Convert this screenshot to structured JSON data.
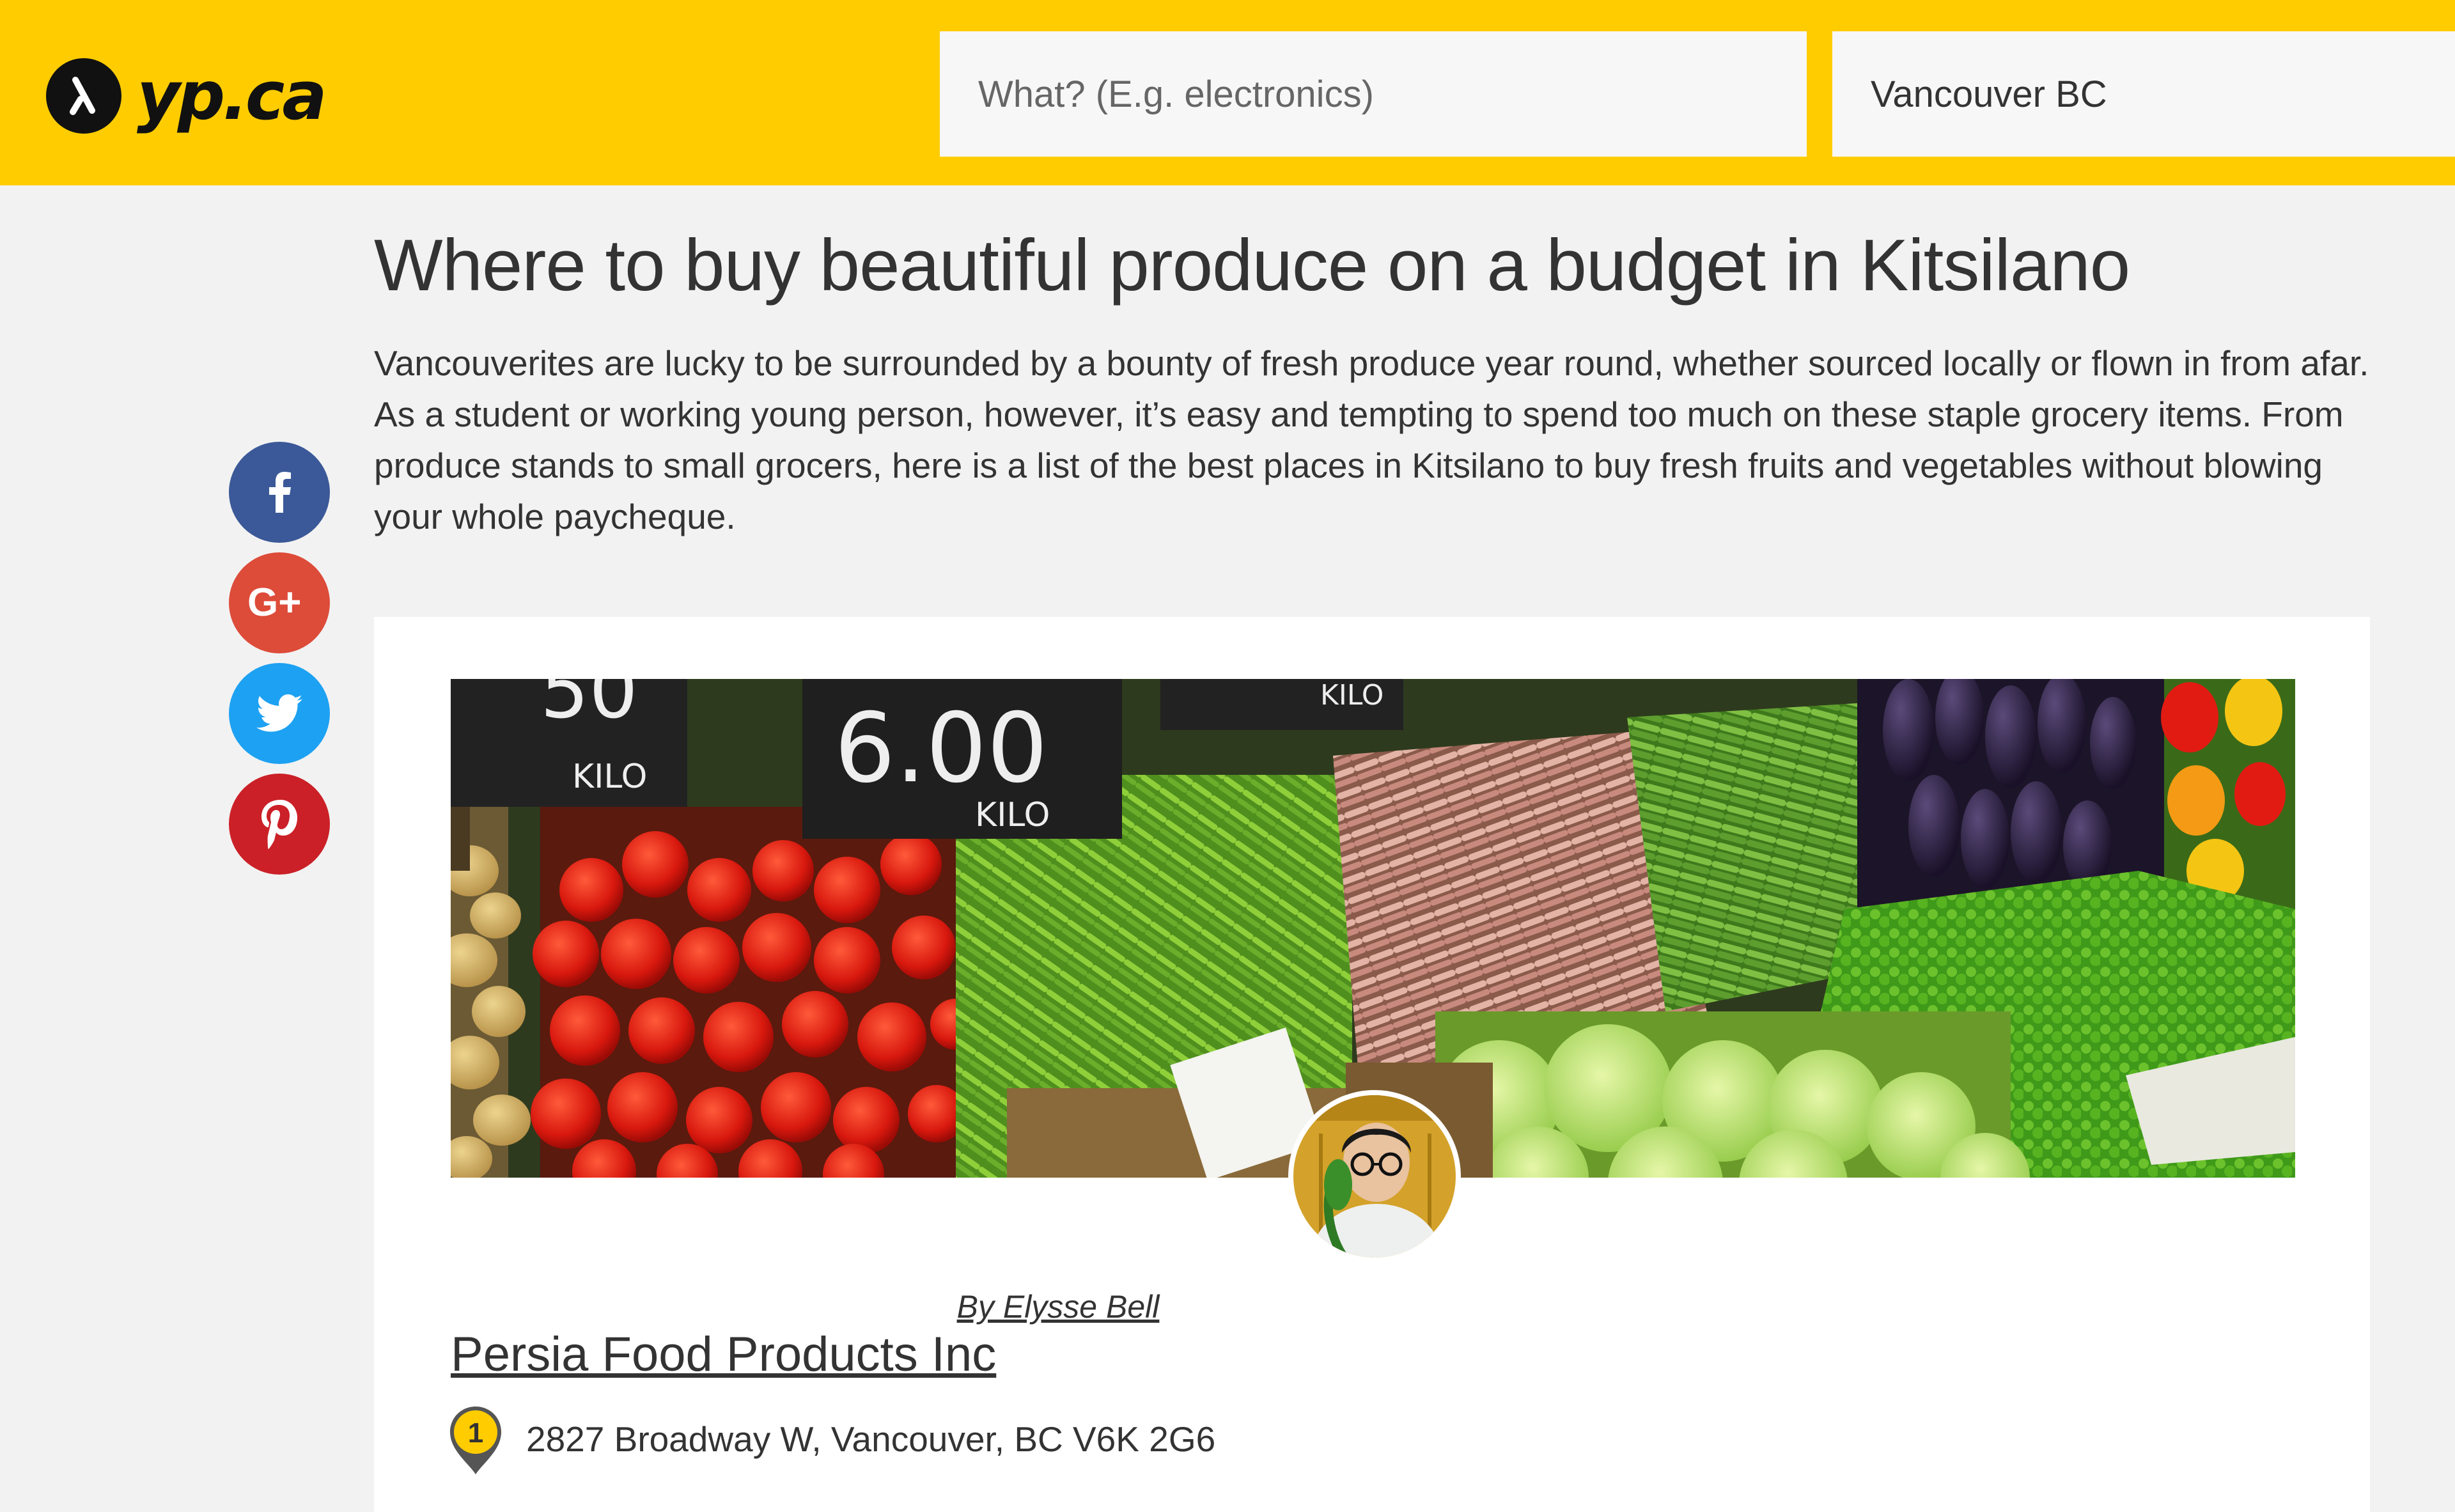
{
  "header": {
    "logo_text": "yp.ca",
    "search_what_placeholder": "What? (E.g. electronics)",
    "search_where_value": "Vancouver BC"
  },
  "article": {
    "title": "Where to buy beautiful produce on a budget in Kitsilano",
    "intro": "Vancouverites are lucky to be surrounded by a bounty of fresh produce year round, whether sourced locally or flown in from afar. As a student or working young person, however, it’s easy and tempting to spend too much on these staple grocery items. From produce stands to small grocers, here is a list of the best places in Kitsilano to buy fresh fruits and vegetables without blowing your whole paycheque.",
    "byline": "By Elysse Bell"
  },
  "social": [
    {
      "name": "facebook",
      "icon": "facebook-icon",
      "color": "#3b5998"
    },
    {
      "name": "google-plus",
      "icon": "google-plus-icon",
      "color": "#dd4b39"
    },
    {
      "name": "twitter",
      "icon": "twitter-icon",
      "color": "#1da1f2"
    },
    {
      "name": "pinterest",
      "icon": "pinterest-icon",
      "color": "#cb2027"
    }
  ],
  "hero_signs": {
    "sign1": "50",
    "sign1_unit": "KILO",
    "sign2": "6.00",
    "sign2_unit": "KILO",
    "sign3_unit": "KILO"
  },
  "listing": {
    "number": "1",
    "name": "Persia Food Products Inc",
    "address": "2827 Broadway W, Vancouver, BC V6K 2G6"
  },
  "colors": {
    "brand_yellow": "#ffcc00",
    "page_bg": "#f2f2f2"
  }
}
